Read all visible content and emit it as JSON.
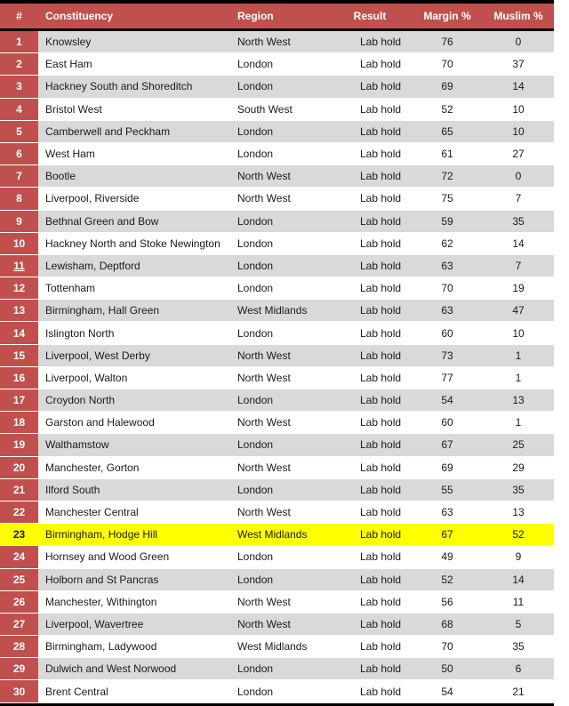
{
  "headers": {
    "num": "#",
    "constituency": "Constituency",
    "region": "Region",
    "result": "Result",
    "margin": "Margin %",
    "muslim": "Muslim %"
  },
  "highlight_color": "#ffff00",
  "header_color": "#c0504d",
  "highlighted_row": 23,
  "underlined_row": 11,
  "rows": [
    {
      "num": "1",
      "constituency": "Knowsley",
      "region": "North West",
      "result": "Lab hold",
      "margin": "76",
      "muslim": "0"
    },
    {
      "num": "2",
      "constituency": "East Ham",
      "region": "London",
      "result": "Lab hold",
      "margin": "70",
      "muslim": "37"
    },
    {
      "num": "3",
      "constituency": "Hackney South and Shoreditch",
      "region": "London",
      "result": "Lab hold",
      "margin": "69",
      "muslim": "14"
    },
    {
      "num": "4",
      "constituency": "Bristol West",
      "region": "South West",
      "result": "Lab hold",
      "margin": "52",
      "muslim": "10"
    },
    {
      "num": "5",
      "constituency": "Camberwell and Peckham",
      "region": "London",
      "result": "Lab hold",
      "margin": "65",
      "muslim": "10"
    },
    {
      "num": "6",
      "constituency": "West Ham",
      "region": "London",
      "result": "Lab hold",
      "margin": "61",
      "muslim": "27"
    },
    {
      "num": "7",
      "constituency": "Bootle",
      "region": "North West",
      "result": "Lab hold",
      "margin": "72",
      "muslim": "0"
    },
    {
      "num": "8",
      "constituency": "Liverpool, Riverside",
      "region": "North West",
      "result": "Lab hold",
      "margin": "75",
      "muslim": "7"
    },
    {
      "num": "9",
      "constituency": "Bethnal Green and Bow",
      "region": "London",
      "result": "Lab hold",
      "margin": "59",
      "muslim": "35"
    },
    {
      "num": "10",
      "constituency": "Hackney North and Stoke Newington",
      "region": "London",
      "result": "Lab hold",
      "margin": "62",
      "muslim": "14"
    },
    {
      "num": "11",
      "constituency": "Lewisham, Deptford",
      "region": "London",
      "result": "Lab hold",
      "margin": "63",
      "muslim": "7"
    },
    {
      "num": "12",
      "constituency": "Tottenham",
      "region": "London",
      "result": "Lab hold",
      "margin": "70",
      "muslim": "19"
    },
    {
      "num": "13",
      "constituency": "Birmingham, Hall Green",
      "region": "West Midlands",
      "result": "Lab hold",
      "margin": "63",
      "muslim": "47"
    },
    {
      "num": "14",
      "constituency": "Islington North",
      "region": "London",
      "result": "Lab hold",
      "margin": "60",
      "muslim": "10"
    },
    {
      "num": "15",
      "constituency": "Liverpool, West Derby",
      "region": "North West",
      "result": "Lab hold",
      "margin": "73",
      "muslim": "1"
    },
    {
      "num": "16",
      "constituency": "Liverpool, Walton",
      "region": "North West",
      "result": "Lab hold",
      "margin": "77",
      "muslim": "1"
    },
    {
      "num": "17",
      "constituency": "Croydon North",
      "region": "London",
      "result": "Lab hold",
      "margin": "54",
      "muslim": "13"
    },
    {
      "num": "18",
      "constituency": "Garston and Halewood",
      "region": "North West",
      "result": "Lab hold",
      "margin": "60",
      "muslim": "1"
    },
    {
      "num": "19",
      "constituency": "Walthamstow",
      "region": "London",
      "result": "Lab hold",
      "margin": "67",
      "muslim": "25"
    },
    {
      "num": "20",
      "constituency": "Manchester, Gorton",
      "region": "North West",
      "result": "Lab hold",
      "margin": "69",
      "muslim": "29"
    },
    {
      "num": "21",
      "constituency": "Ilford South",
      "region": "London",
      "result": "Lab hold",
      "margin": "55",
      "muslim": "35"
    },
    {
      "num": "22",
      "constituency": "Manchester Central",
      "region": "North West",
      "result": "Lab hold",
      "margin": "63",
      "muslim": "13"
    },
    {
      "num": "23",
      "constituency": "Birmingham, Hodge Hill",
      "region": "West Midlands",
      "result": "Lab hold",
      "margin": "67",
      "muslim": "52"
    },
    {
      "num": "24",
      "constituency": "Hornsey and Wood Green",
      "region": "London",
      "result": "Lab hold",
      "margin": "49",
      "muslim": "9"
    },
    {
      "num": "25",
      "constituency": "Holborn and St Pancras",
      "region": "London",
      "result": "Lab hold",
      "margin": "52",
      "muslim": "14"
    },
    {
      "num": "26",
      "constituency": "Manchester, Withington",
      "region": "North West",
      "result": "Lab hold",
      "margin": "56",
      "muslim": "11"
    },
    {
      "num": "27",
      "constituency": "Liverpool, Wavertree",
      "region": "North West",
      "result": "Lab hold",
      "margin": "68",
      "muslim": "5"
    },
    {
      "num": "28",
      "constituency": "Birmingham, Ladywood",
      "region": "West Midlands",
      "result": "Lab hold",
      "margin": "70",
      "muslim": "35"
    },
    {
      "num": "29",
      "constituency": "Dulwich and West Norwood",
      "region": "London",
      "result": "Lab hold",
      "margin": "50",
      "muslim": "6"
    },
    {
      "num": "30",
      "constituency": "Brent Central",
      "region": "London",
      "result": "Lab hold",
      "margin": "54",
      "muslim": "21"
    }
  ]
}
